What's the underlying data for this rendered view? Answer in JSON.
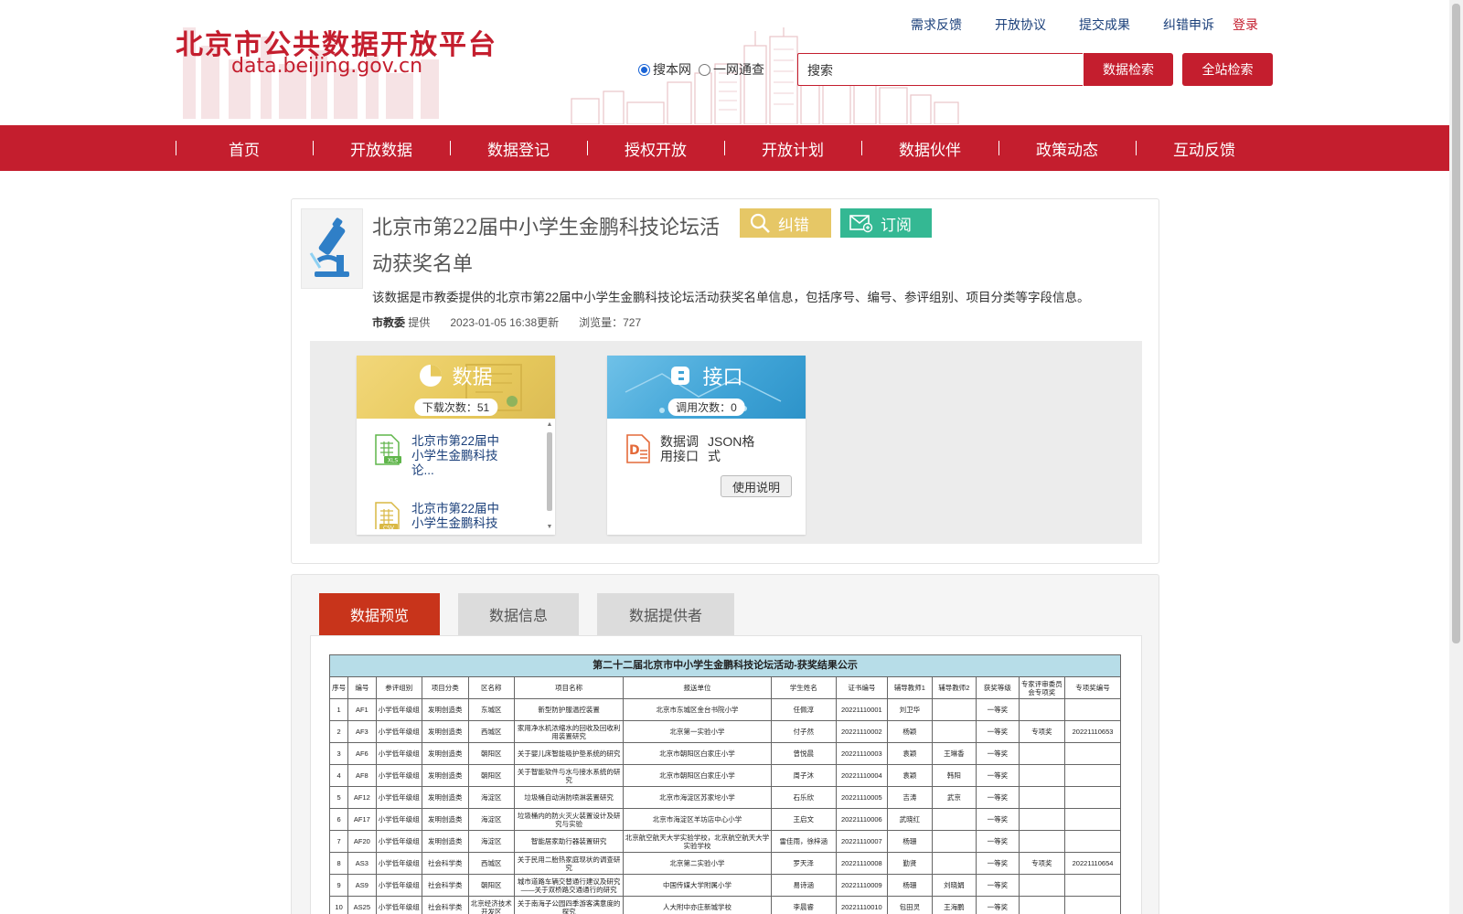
{
  "site": {
    "logo_title": "北京市公共数据开放平台",
    "logo_url": "data.beijing.gov.cn"
  },
  "toplinks": [
    "需求反馈",
    "开放协议",
    "提交成果",
    "纠错申诉"
  ],
  "login_label": "登录",
  "search": {
    "radio_site": "搜本网",
    "radio_all": "一网通查",
    "placeholder": "搜索",
    "btn_data": "数据检索",
    "btn_site": "全站检索"
  },
  "nav": [
    "首页",
    "开放数据",
    "数据登记",
    "授权开放",
    "开放计划",
    "数据伙伴",
    "政策动态",
    "互动反馈"
  ],
  "dataset": {
    "title": "北京市第22届中小学生金鹏科技论坛活动获奖名单",
    "btn_correct": "纠错",
    "btn_subscribe": "订阅",
    "description": "该数据是市教委提供的北京市第22届中小学生金鹏科技论坛活动获奖名单信息，包括序号、编号、参评组别、项目分类等字段信息。",
    "provider": "市教委",
    "provider_suffix": "提供",
    "updated": "2023-01-05 16:38更新",
    "views": "浏览量：727"
  },
  "data_box": {
    "title": "数据",
    "count": "下载次数：51",
    "files": [
      {
        "type": "XLS",
        "name": "北京市第22届中小学生金鹏科技论..."
      },
      {
        "type": "CSV",
        "name": "北京市第22届中小学生金鹏科技论..."
      }
    ]
  },
  "api_box": {
    "title": "接口",
    "count": "调用次数：0",
    "col1": "数据调用接口",
    "col2": "JSON格式",
    "manual": "使用说明"
  },
  "tabs": [
    "数据预览",
    "数据信息",
    "数据提供者"
  ],
  "preview_table": {
    "caption": "第二十二届北京市中小学生金鹏科技论坛活动-获奖结果公示",
    "headers": [
      "序号",
      "编号",
      "参评组别",
      "项目分类",
      "区名称",
      "项目名称",
      "报送单位",
      "学生姓名",
      "证书编号",
      "辅导教师1",
      "辅导教师2",
      "获奖等级",
      "专家评审委员会专项奖",
      "专项奖编号"
    ],
    "rows": [
      [
        "1",
        "AF1",
        "小学低年级组",
        "发明创造类",
        "东城区",
        "新型防护服温控装置",
        "北京市东城区金台书院小学",
        "任佩淳",
        "20221110001",
        "刘卫华",
        "",
        "一等奖",
        "",
        ""
      ],
      [
        "2",
        "AF3",
        "小学低年级组",
        "发明创造类",
        "西城区",
        "家用净水机浓缩水的回收及回收利用装置研究",
        "北京第一实验小学",
        "付子然",
        "20221110002",
        "杨颖",
        "",
        "一等奖",
        "专项奖",
        "20221110653"
      ],
      [
        "3",
        "AF6",
        "小学低年级组",
        "发明创造类",
        "朝阳区",
        "关于婴儿床智能吸护垫系统的研究",
        "北京市朝阳区白家庄小学",
        "曾悦晨",
        "20221110003",
        "袁颖",
        "王琳香",
        "一等奖",
        "",
        ""
      ],
      [
        "4",
        "AF8",
        "小学低年级组",
        "发明创造类",
        "朝阳区",
        "关于智能软件与水与接水系统的研究",
        "北京市朝阳区白家庄小学",
        "周子沐",
        "20221110004",
        "袁颖",
        "韩阳",
        "一等奖",
        "",
        ""
      ],
      [
        "5",
        "AF12",
        "小学低年级组",
        "发明创造类",
        "海淀区",
        "垃圾桶自动消防喷淋装置研究",
        "北京市海淀区苏家坨小学",
        "石乐欣",
        "20221110005",
        "吉涛",
        "武京",
        "一等奖",
        "",
        ""
      ],
      [
        "6",
        "AF17",
        "小学低年级组",
        "发明创造类",
        "海淀区",
        "垃圾桶内的防火灭火装置设计及研究与实验",
        "北京市海淀区羊坊店中心小学",
        "王启文",
        "20221110006",
        "武晓红",
        "",
        "一等奖",
        "",
        ""
      ],
      [
        "7",
        "AF20",
        "小学低年级组",
        "发明创造类",
        "海淀区",
        "智能居家助行器装置研究",
        "北京航空航天大学实验学校，北京航空航天大学实验学校",
        "雷佳雨，徐梓涵",
        "20221110007",
        "杨珊",
        "",
        "一等奖",
        "",
        ""
      ],
      [
        "8",
        "AS3",
        "小学低年级组",
        "社会科学类",
        "西城区",
        "关于民用二胎热家庭现状的调查研究",
        "北京第二实验小学",
        "罗天泽",
        "20221110008",
        "勤贤",
        "",
        "一等奖",
        "专项奖",
        "20221110654"
      ],
      [
        "9",
        "AS9",
        "小学低年级组",
        "社会科学类",
        "朝阳区",
        "城市道路车辆交替通行建议及研究——关于双桥路交通通行的研究",
        "中国传媒大学附属小学",
        "易诗涵",
        "20221110009",
        "杨珊",
        "刘晓娟",
        "一等奖",
        "",
        ""
      ],
      [
        "10",
        "AS25",
        "小学低年级组",
        "社会科学类",
        "北京经济技术开发区",
        "关于南海子公园四季游客满意度的探究",
        "人大附中亦庄新城学校",
        "李晨睿",
        "20221110010",
        "包田灵",
        "王海鹏",
        "一等奖",
        "",
        ""
      ]
    ]
  },
  "colors": {
    "brand_red": "#c41e2e",
    "data_box": "#e7c95c",
    "api_box": "#3fa3d6",
    "correct_btn": "#e6c766",
    "subscribe_btn": "#34b893",
    "tab_active": "#c8341b"
  }
}
